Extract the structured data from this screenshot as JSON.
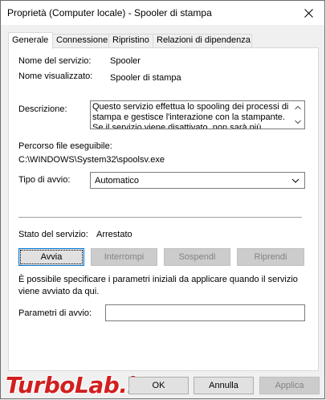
{
  "window": {
    "title": "Proprietà (Computer locale) - Spooler di stampa"
  },
  "tabs": [
    {
      "label": "Generale",
      "active": true
    },
    {
      "label": "Connessione",
      "active": false
    },
    {
      "label": "Ripristino",
      "active": false
    },
    {
      "label": "Relazioni di dipendenza",
      "active": false
    }
  ],
  "general": {
    "service_name_label": "Nome del servizio:",
    "service_name_value": "Spooler",
    "display_name_label": "Nome visualizzato:",
    "display_name_value": "Spooler di stampa",
    "description_label": "Descrizione:",
    "description_text": "Questo servizio effettua lo spooling dei processi di stampa e gestisce l'interazione con la stampante. Se il servizio viene disattivato, non sarà più possibile",
    "exe_path_label": "Percorso file eseguibile:",
    "exe_path_value": "C:\\WINDOWS\\System32\\spoolsv.exe",
    "startup_type_label": "Tipo di avvio:",
    "startup_type_value": "Automatico",
    "status_label": "Stato del servizio:",
    "status_value": "Arrestato",
    "buttons": {
      "start": "Avvia",
      "stop": "Interrompi",
      "pause": "Sospendi",
      "resume": "Riprendi"
    },
    "params_info": "È possibile specificare i parametri iniziali da applicare quando il servizio viene avviato da qui.",
    "start_params_label": "Parametri di avvio:",
    "start_params_value": ""
  },
  "footer": {
    "ok": "OK",
    "cancel": "Annulla",
    "apply": "Applica"
  },
  "watermark": "TurboLab.it",
  "colors": {
    "focus_border": "#0078d7",
    "disabled_bg": "#cccccc",
    "disabled_text": "#838383",
    "watermark": "#d11f1f"
  }
}
